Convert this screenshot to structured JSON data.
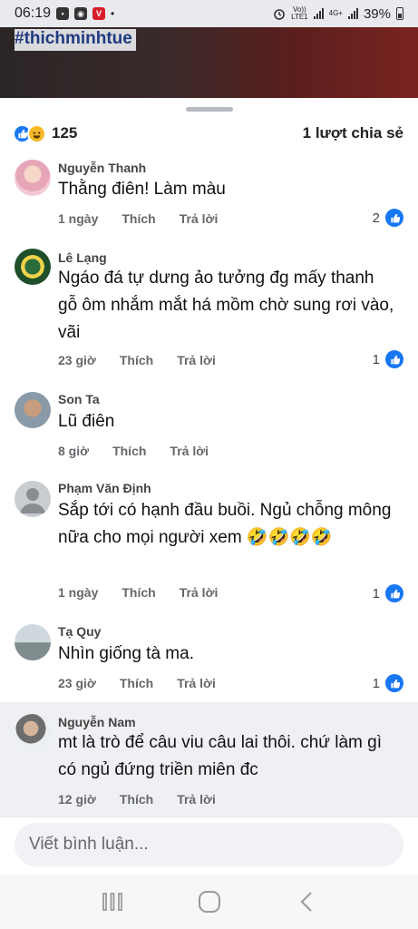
{
  "status_bar": {
    "time": "06:19",
    "volte": "Vo))\nLTE1",
    "network": "4G+",
    "battery": "39%"
  },
  "header": {
    "hashtag": "#thichminhtue"
  },
  "summary": {
    "reaction_count": "125",
    "shares": "1 lượt chia sẻ"
  },
  "comments": [
    {
      "name": "Nguyễn Thanh",
      "text": "Thằng điên! Làm màu",
      "time": "1 ngày",
      "like_label": "Thích",
      "reply_label": "Trả lời",
      "likes": "2"
    },
    {
      "name": "Lê Lạng",
      "text": "Ngáo đá tự dưng ảo tưởng đg mấy thanh gỗ ôm nhắm mắt há mồm chờ sung rơi vào, vãi",
      "time": "23 giờ",
      "like_label": "Thích",
      "reply_label": "Trả lời",
      "likes": "1"
    },
    {
      "name": "Son Ta",
      "text": "Lũ điên",
      "time": "8 giờ",
      "like_label": "Thích",
      "reply_label": "Trả lời",
      "likes": ""
    },
    {
      "name": "Phạm Văn Định",
      "text": "Sắp tới có hạnh đầu buồi. Ngủ chỗng mông nữa cho mọi người xem 🤣🤣🤣🤣",
      "time": "1 ngày",
      "like_label": "Thích",
      "reply_label": "Trả lời",
      "likes": "1"
    },
    {
      "name": "Tạ Quy",
      "text": "Nhìn giống tà ma.",
      "time": "23 giờ",
      "like_label": "Thích",
      "reply_label": "Trả lời",
      "likes": "1"
    },
    {
      "name": "Nguyễn Nam",
      "text": "mt là trò để câu viu câu lai thôi. chứ làm gì có ngủ đứng triền miên đc",
      "time": "12 giờ",
      "like_label": "Thích",
      "reply_label": "Trả lời",
      "likes": ""
    }
  ],
  "composer": {
    "placeholder": "Viết bình luận..."
  },
  "colors": {
    "accent": "#1877f2",
    "haha": "#f7b928",
    "meta_text": "#65676b"
  }
}
